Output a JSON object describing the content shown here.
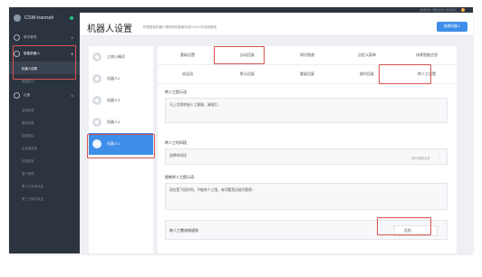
{
  "app": {
    "name": "CSM-hannah",
    "page_title": "机器人设置",
    "page_subtitle": "呼语智能机器人帮助您的客服实现7x24小时全网服务",
    "primary_button": "创建机器人",
    "topbar_links": "在线状态 | 帮助文档 | 联系我们"
  },
  "sidebar": {
    "groups": [
      {
        "label": "联系管理",
        "icon": "chat-icon"
      },
      {
        "label": "智能机器人",
        "icon": "robot-icon",
        "active": true,
        "sub": [
          {
            "label": "机器人设置",
            "active": true
          },
          {
            "label": "数据统计"
          }
        ]
      },
      {
        "label": "设置",
        "icon": "gear-icon",
        "sub": [
          {
            "label": "坐席管理"
          },
          {
            "label": "渠道设置"
          },
          {
            "label": "智能路由"
          },
          {
            "label": "会话满意度"
          },
          {
            "label": "快捷回复"
          },
          {
            "label": "客户管理"
          },
          {
            "label": "第三方系统对接"
          },
          {
            "label": "第三方事件推送"
          }
        ]
      }
    ]
  },
  "robots": [
    {
      "name": "江南小精灵"
    },
    {
      "name": "机器人2"
    },
    {
      "name": "机器人3"
    },
    {
      "name": "机器人4"
    },
    {
      "name": "机器人1",
      "active": true
    }
  ],
  "tabs_row1": [
    "基础设置",
    "自动回复",
    "知识图谱",
    "自定义菜单",
    "场景智能应答"
  ],
  "tabs_row2": [
    "欢迎语",
    "默认回复",
    "重复回复",
    "超时回复",
    "转人工设置"
  ],
  "form": {
    "prompt_label": "转人工提示语",
    "prompt_value": "马上为您转接人工客服，请稍后...",
    "time_label": "转人工时间段",
    "time_placeholder": "选择时间段",
    "time_value": "全时间段允许",
    "limit_label": "限制转人工提示语",
    "limit_value": "现在是下班时间，不能转人工哦，有问题您还能问我呢~",
    "robot_rule_label": "转人工需求按规则",
    "robot_rule_value": "否则"
  },
  "colors": {
    "accent": "#3d8ee8",
    "highlight": "#d9534f",
    "sidebar_bg": "#2c3440"
  }
}
